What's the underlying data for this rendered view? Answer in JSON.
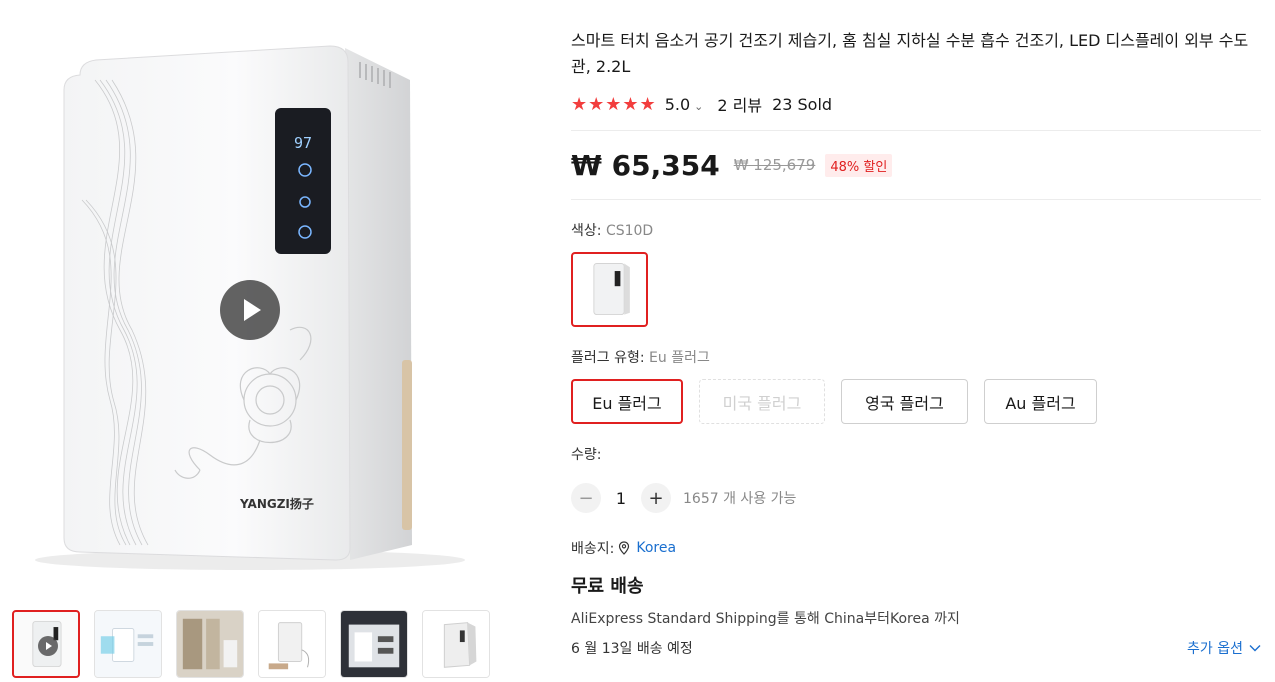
{
  "product": {
    "title": "스마트 터치 음소거 공기 건조기 제습기, 홈 침실 지하실 수분 흡수 건조기, LED 디스플레이 외부 수도관, 2.2L",
    "stars": "★★★★★",
    "rating": "5.0",
    "reviews": "2 리뷰",
    "sold": "23 Sold"
  },
  "price": {
    "current": "₩ 65,354",
    "original": "₩ 125,679",
    "discount": "48% 할인"
  },
  "color_option": {
    "label": "색상: ",
    "value": "CS10D"
  },
  "plug_option": {
    "label": "플러그 유형: ",
    "value": "Eu 플러그",
    "choices": [
      "Eu 플러그",
      "미국 플러그",
      "영국 플러그",
      "Au 플러그"
    ]
  },
  "quantity": {
    "label": "수량:",
    "minus": "−",
    "value": "1",
    "plus": "+",
    "available": "1657 개 사용 가능"
  },
  "shipping": {
    "label": "배송지:",
    "country": "Korea",
    "free": "무료 배송",
    "description": "AliExpress Standard Shipping를 통해 China부터Korea 까지",
    "delivery": "6 월 13일 배송 예정",
    "more_options": "추가 옵션"
  },
  "device": {
    "display_digits": "97",
    "brand": "YANGZI扬子"
  },
  "colors": {
    "accent_red": "#e02020",
    "star_red": "#f23d3d",
    "link_blue": "#1a6fcf"
  },
  "icons": {
    "play": "play-icon",
    "pin": "location-pin-icon",
    "chevron": "chevron-down-icon"
  }
}
